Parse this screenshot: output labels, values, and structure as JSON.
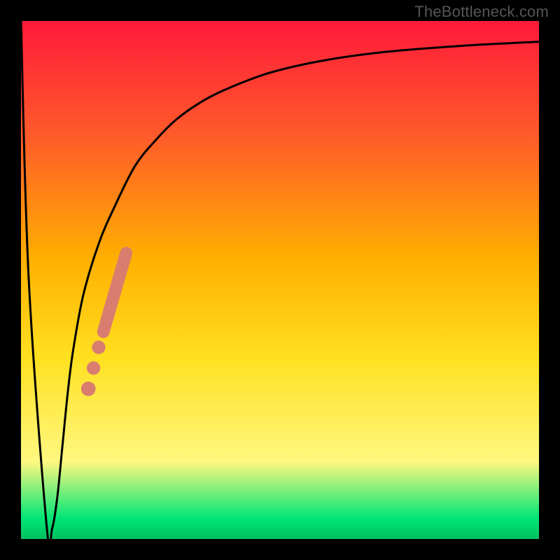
{
  "watermark": "TheBottleneck.com",
  "colors": {
    "page_bg": "#000000",
    "watermark": "#555555",
    "gradient_top": "#ff1a3a",
    "gradient_upper": "#ff5a2a",
    "gradient_mid_upper": "#ffb000",
    "gradient_mid": "#ffe020",
    "gradient_lower": "#fff880",
    "gradient_bottom": "#00e676",
    "gradient_bottom2": "#00c060",
    "curve": "#000000",
    "marker": "#d97d6e"
  },
  "chart_data": {
    "type": "line",
    "title": "",
    "xlabel": "",
    "ylabel": "",
    "xlim": [
      0,
      100
    ],
    "ylim": [
      0,
      100
    ],
    "x": [
      0,
      1.5,
      5,
      6,
      7,
      8,
      9,
      10,
      12,
      15,
      18,
      22,
      26,
      30,
      35,
      40,
      48,
      58,
      70,
      85,
      100
    ],
    "values": [
      100,
      50,
      2,
      2,
      8,
      18,
      28,
      36,
      47,
      57,
      64,
      72,
      77,
      81,
      84.5,
      87,
      90,
      92.3,
      94,
      95.2,
      96
    ],
    "series": [
      {
        "name": "bottleneck-curve",
        "x": [
          0,
          1.5,
          5,
          6,
          7,
          8,
          9,
          10,
          12,
          15,
          18,
          22,
          26,
          30,
          35,
          40,
          48,
          58,
          70,
          85,
          100
        ],
        "y": [
          100,
          50,
          2,
          2,
          8,
          18,
          28,
          36,
          47,
          57,
          64,
          72,
          77,
          81,
          84.5,
          87,
          90,
          92.3,
          94,
          95.2,
          96
        ]
      }
    ],
    "markers": [
      {
        "type": "segment",
        "x0": 15.9,
        "y0": 40.0,
        "x1": 20.3,
        "y1": 55.2,
        "width": 2.4
      },
      {
        "type": "dot",
        "x": 15.0,
        "y": 37.0,
        "r": 1.3
      },
      {
        "type": "dot",
        "x": 14.0,
        "y": 33.0,
        "r": 1.3
      },
      {
        "type": "dot",
        "x": 13.0,
        "y": 29.0,
        "r": 1.4
      }
    ]
  }
}
